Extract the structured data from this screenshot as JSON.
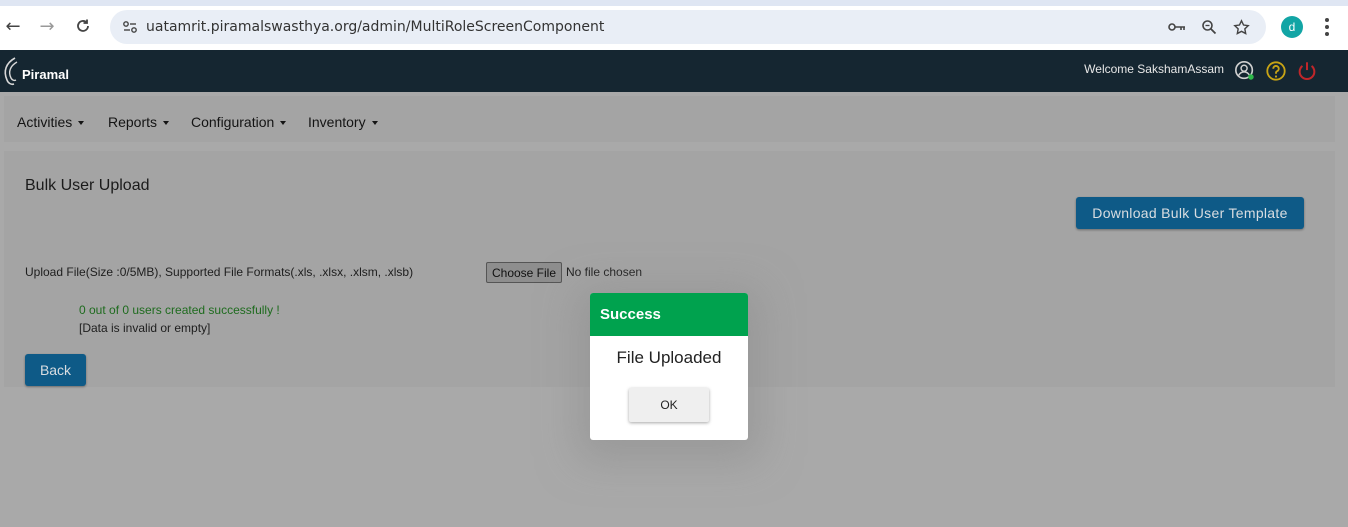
{
  "browser": {
    "url": "uatamrit.piramalswasthya.org/admin/MultiRoleScreenComponent",
    "profile_initial": "d",
    "icons": [
      "back-arrow-icon",
      "forward-arrow-icon",
      "reload-icon",
      "site-settings-icon",
      "password-key-icon",
      "zoom-icon",
      "bookmark-star-icon",
      "more-menu-icon"
    ]
  },
  "header": {
    "logo_text": "Piramal",
    "welcome_text": "Welcome SakshamAssam",
    "icons": [
      "user-profile-icon",
      "help-icon",
      "power-icon"
    ],
    "colors": {
      "background": "#152631",
      "help": "#c8a415",
      "power": "#c0262a"
    }
  },
  "menu": {
    "items": [
      "Activities",
      "Reports",
      "Configuration",
      "Inventory"
    ]
  },
  "card": {
    "title": "Bulk User Upload",
    "download_label": "Download Bulk User Template",
    "upload_label": "Upload File(Size :0/5MB), Supported File Formats(.xls, .xlsx, .xlsm, .xlsb)",
    "file_button_label": "Choose File",
    "file_status": "No file chosen",
    "success_message": "0 out of 0 users created successfully !",
    "error_message": "[Data is invalid or empty]",
    "back_label": "Back"
  },
  "dialog": {
    "title": "Success",
    "message": "File Uploaded",
    "ok_label": "OK",
    "colors": {
      "header": "#00a24e"
    }
  }
}
